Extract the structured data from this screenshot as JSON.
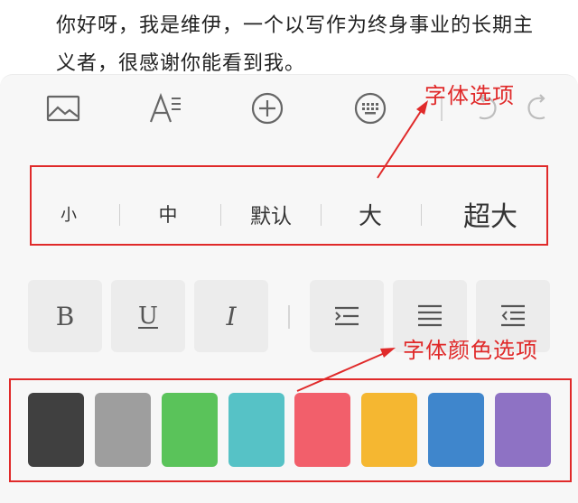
{
  "editor": {
    "body_text": "你好呀，我是维伊，一个以写作为终身事业的长期主义者，很感谢你能看到我。"
  },
  "toolbar": {
    "items": [
      {
        "icon": "image-icon"
      },
      {
        "icon": "font-style-icon"
      },
      {
        "icon": "add-circle-icon"
      },
      {
        "icon": "keyboard-icon"
      },
      {
        "icon": "undo-icon"
      },
      {
        "icon": "redo-icon"
      }
    ]
  },
  "font_sizes": [
    "小",
    "中",
    "默认",
    "大",
    "超大"
  ],
  "format_buttons": [
    {
      "label": "B",
      "icon": "bold-icon"
    },
    {
      "label": "U",
      "icon": "underline-icon"
    },
    {
      "label": "I",
      "icon": "italic-icon"
    },
    {
      "icon": "align-center-icon"
    },
    {
      "icon": "align-justify-icon"
    },
    {
      "icon": "indent-icon"
    }
  ],
  "colors": [
    "#404040",
    "#9e9e9e",
    "#5ac35a",
    "#56c2c6",
    "#f25f6b",
    "#f5b731",
    "#3f86cc",
    "#8e72c4"
  ],
  "annotations": {
    "font_options": "字体选项",
    "font_color_options": "字体颜色选项",
    "color": "#e02a2a"
  }
}
